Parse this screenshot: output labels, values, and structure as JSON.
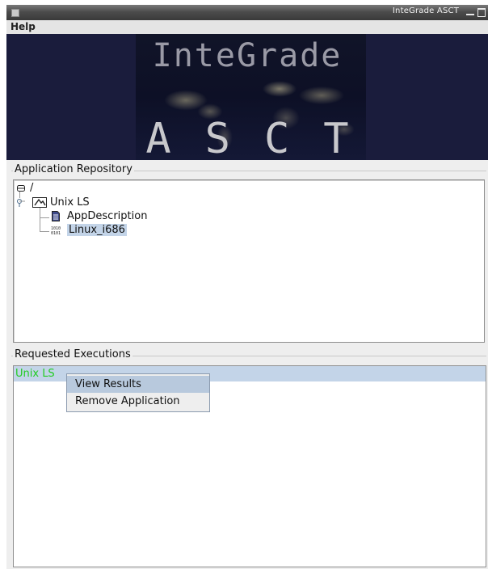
{
  "window": {
    "title": "InteGrade ASCT"
  },
  "menubar": {
    "help": "Help"
  },
  "banner": {
    "top_text": "InteGrade",
    "bottom_text": "ASCT"
  },
  "repository": {
    "group_title": "Application Repository",
    "root_label": "/",
    "app_node": "Unix LS",
    "children": [
      "AppDescription",
      "Linux_i686"
    ],
    "selected": "Linux_i686"
  },
  "executions": {
    "group_title": "Requested Executions",
    "rows": [
      {
        "label": "Unix LS",
        "color": "#22cc22"
      }
    ]
  },
  "context_menu": {
    "items": [
      "View Results",
      "Remove Application"
    ],
    "highlighted": "View Results"
  },
  "colors": {
    "selection": "#c3d4e8",
    "menu_highlight": "#b8c9dd",
    "banner_bg": "#1a1c3c"
  }
}
